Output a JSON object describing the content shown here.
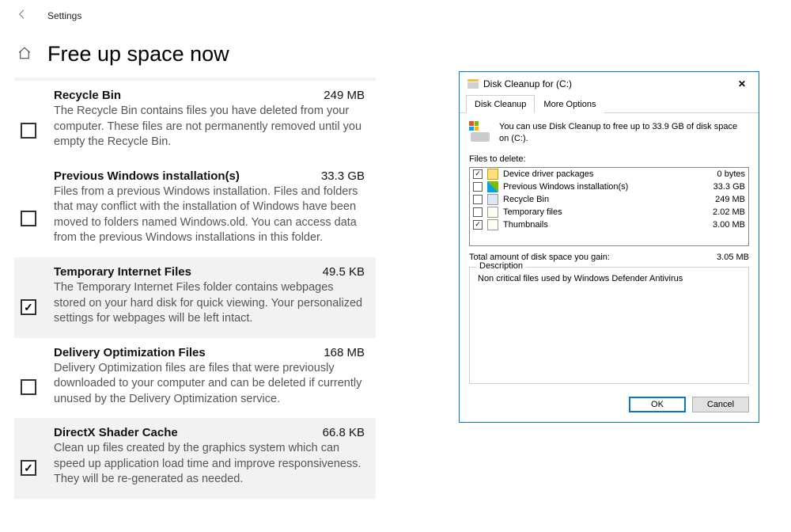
{
  "settings": {
    "back_label": "Settings",
    "page_title": "Free up space now",
    "items": [
      {
        "title": "Recycle Bin",
        "size": "249 MB",
        "checked": false,
        "highlight": false,
        "desc": "The Recycle Bin contains files you have deleted from your computer. These files are not permanently removed until you empty the Recycle Bin."
      },
      {
        "title": "Previous Windows installation(s)",
        "size": "33.3 GB",
        "checked": false,
        "highlight": false,
        "desc": "Files from a previous Windows installation.  Files and folders that may conflict with the installation of Windows have been moved to folders named Windows.old.  You can access data from the previous Windows installations in this folder."
      },
      {
        "title": "Temporary Internet Files",
        "size": "49.5 KB",
        "checked": true,
        "highlight": true,
        "desc": "The Temporary Internet Files folder contains webpages stored on your hard disk for quick viewing. Your personalized settings for webpages will be left intact."
      },
      {
        "title": "Delivery Optimization Files",
        "size": "168 MB",
        "checked": false,
        "highlight": false,
        "desc": "Delivery Optimization files are files that were previously downloaded to your computer and can be deleted if currently unused by the Delivery Optimization service."
      },
      {
        "title": "DirectX Shader Cache",
        "size": "66.8 KB",
        "checked": true,
        "highlight": true,
        "desc": "Clean up files created by the graphics system which can speed up application load time and improve responsiveness. They will be re-generated as needed."
      }
    ]
  },
  "dialog": {
    "title": "Disk Cleanup for  (C:)",
    "tabs": {
      "cleanup": "Disk Cleanup",
      "more": "More Options"
    },
    "info_text": "You can use Disk Cleanup to free up to 33.9 GB of disk space on  (C:).",
    "files_label": "Files to delete:",
    "files": [
      {
        "checked": true,
        "icon": "pkg",
        "name": "Device driver packages",
        "size": "0 bytes"
      },
      {
        "checked": false,
        "icon": "win",
        "name": "Previous Windows installation(s)",
        "size": "33.3 GB"
      },
      {
        "checked": false,
        "icon": "bin",
        "name": "Recycle Bin",
        "size": "249 MB"
      },
      {
        "checked": false,
        "icon": "tmp",
        "name": "Temporary files",
        "size": "2.02 MB"
      },
      {
        "checked": true,
        "icon": "thmb",
        "name": "Thumbnails",
        "size": "3.00 MB"
      }
    ],
    "total_label": "Total amount of disk space you gain:",
    "total_value": "3.05 MB",
    "desc_legend": "Description",
    "desc_text": "Non critical files used by Windows Defender Antivirus",
    "ok": "OK",
    "cancel": "Cancel"
  }
}
